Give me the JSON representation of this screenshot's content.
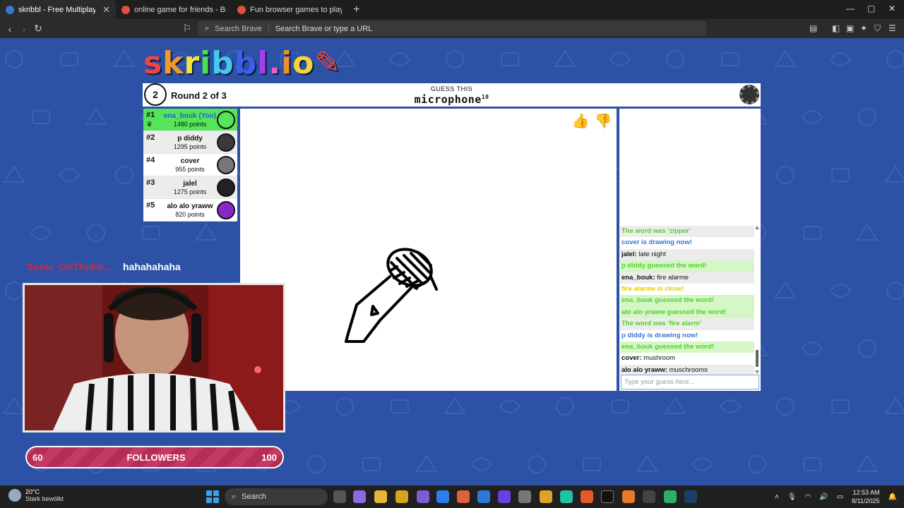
{
  "browser": {
    "tabs": [
      {
        "label": "skribbl - Free Multiplayer Dra",
        "active": true,
        "favicon_color": "#3a78d8"
      },
      {
        "label": "online game for friends - Brave Sear",
        "active": false,
        "favicon_color": "#e0503a"
      },
      {
        "label": "Fun browser games to play with frie",
        "active": false,
        "favicon_color": "#e0503a"
      }
    ],
    "search_hint": "Search Brave",
    "address_placeholder": "Search Brave or type a URL"
  },
  "game": {
    "logo": "skribbl.io",
    "round_number": "2",
    "round_text": "Round 2 of 3",
    "guess_label": "GUESS THIS",
    "word": "microphone",
    "word_length": "10",
    "players": [
      {
        "rank": "#1",
        "name": "ena_bouk (You)",
        "points": "1480 points",
        "me": true,
        "avatar_color": "#55e45a"
      },
      {
        "rank": "#2",
        "name": "p diddy",
        "points": "1295 points",
        "me": false,
        "avatar_color": "#3a3a3a"
      },
      {
        "rank": "#4",
        "name": "cover",
        "points": "955 points",
        "me": false,
        "avatar_color": "#777777"
      },
      {
        "rank": "#3",
        "name": "jalel",
        "points": "1275 points",
        "me": false,
        "avatar_color": "#222222"
      },
      {
        "rank": "#5",
        "name": "alo alo yraww",
        "points": "820 points",
        "me": false,
        "avatar_color": "#8a27c9"
      }
    ],
    "chat": [
      {
        "type": "green-plain",
        "text": "The word was 'zipper'"
      },
      {
        "type": "blue",
        "text": "cover is drawing now!"
      },
      {
        "type": "user",
        "user": "jalel:",
        "text": " late night"
      },
      {
        "type": "green",
        "text": "p diddy guessed the word!"
      },
      {
        "type": "user",
        "user": "ena_bouk:",
        "text": " fire alarme"
      },
      {
        "type": "orange",
        "text": "fire alarme is close!"
      },
      {
        "type": "green",
        "text": "ena_bouk guessed the word!"
      },
      {
        "type": "green",
        "text": "alo alo yraww guessed the word!"
      },
      {
        "type": "green-plain",
        "text": "The word was 'fire alarm'"
      },
      {
        "type": "blue",
        "text": "p diddy is drawing now!"
      },
      {
        "type": "green",
        "text": "ena_bouk guessed the word!"
      },
      {
        "type": "user",
        "user": "cover:",
        "text": " mushroom"
      },
      {
        "type": "user",
        "user": "alo alo yraww:",
        "text": " muschrooms"
      }
    ],
    "guess_placeholder": "Type your guess here..."
  },
  "stream_overlay": {
    "chat_user": "Sonic_OnTheEd...",
    "chat_message": "hahahahaha",
    "followers_current": "60",
    "followers_label": "FOLLOWERS",
    "followers_goal": "100"
  },
  "taskbar": {
    "temperature": "20°C",
    "weather": "Stark bewölkt",
    "search": "Search",
    "time": "12:53 AM",
    "date": "8/11/2025"
  }
}
